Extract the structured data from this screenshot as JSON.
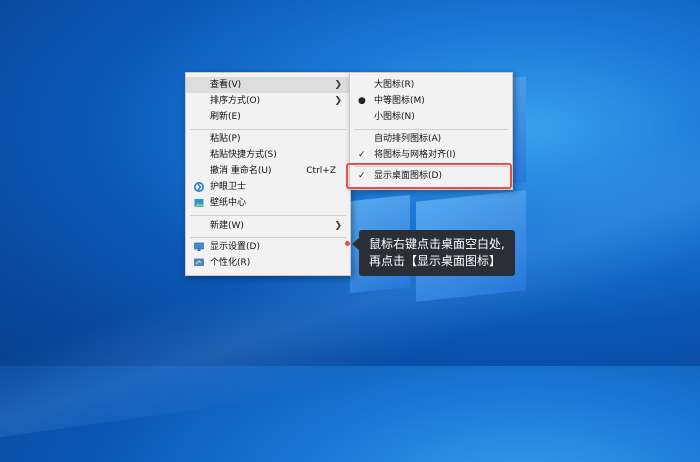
{
  "context_menu": {
    "items": [
      {
        "label": "查看(V)"
      },
      {
        "label": "排序方式(O)"
      },
      {
        "label": "刷新(E)"
      },
      {
        "label": "粘贴(P)"
      },
      {
        "label": "粘贴快捷方式(S)"
      },
      {
        "label": "撤消 重命名(U)",
        "shortcut": "Ctrl+Z"
      },
      {
        "label": "护眼卫士"
      },
      {
        "label": "壁纸中心"
      },
      {
        "label": "新建(W)"
      },
      {
        "label": "显示设置(D)"
      },
      {
        "label": "个性化(R)"
      }
    ]
  },
  "submenu": {
    "items": [
      {
        "label": "大图标(R)"
      },
      {
        "label": "中等图标(M)"
      },
      {
        "label": "小图标(N)"
      },
      {
        "label": "自动排列图标(A)"
      },
      {
        "label": "将图标与网格对齐(I)"
      },
      {
        "label": "显示桌面图标(D)"
      }
    ]
  },
  "callout": {
    "line1": "鼠标右键点击桌面空白处,",
    "line2": "再点击【显示桌面图标】"
  },
  "colors": {
    "highlight_box": "#e25050",
    "callout_bg": "#2b2f35",
    "desktop": "#1a78d6"
  }
}
